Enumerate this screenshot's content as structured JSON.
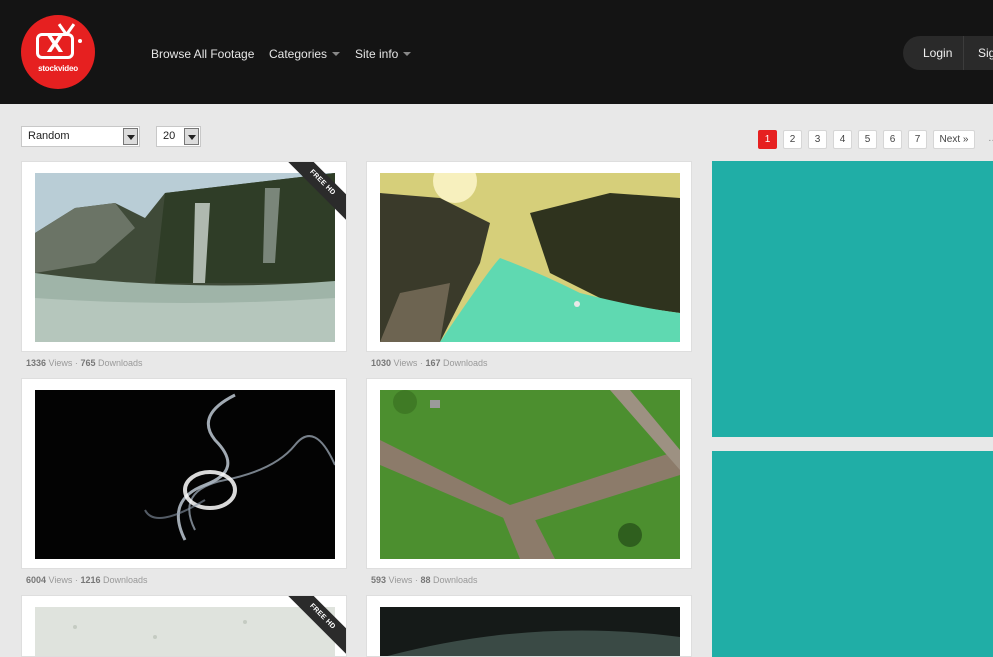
{
  "brand": {
    "logo_text": "stockvideo",
    "logo_mark": "X"
  },
  "nav": {
    "browse": "Browse All Footage",
    "categories": "Categories",
    "site_info": "Site info"
  },
  "auth": {
    "login": "Login",
    "signup": "Sign Up"
  },
  "filters": {
    "sort_value": "Random",
    "per_page_value": "20"
  },
  "pagination": {
    "pages": [
      "1",
      "2",
      "3",
      "4",
      "5",
      "6",
      "7"
    ],
    "active": "1",
    "next": "Next »",
    "ellipsis": "…"
  },
  "videos": [
    {
      "ribbon": "FREE HD",
      "views": "1336",
      "downloads": "765",
      "views_label": "Views",
      "downloads_label": "Downloads",
      "sep": "·"
    },
    {
      "ribbon": "",
      "views": "1030",
      "downloads": "167",
      "views_label": "Views",
      "downloads_label": "Downloads",
      "sep": "·"
    },
    {
      "ribbon": "",
      "views": "6004",
      "downloads": "1216",
      "views_label": "Views",
      "downloads_label": "Downloads",
      "sep": "·"
    },
    {
      "ribbon": "",
      "views": "593",
      "downloads": "88",
      "views_label": "Views",
      "downloads_label": "Downloads",
      "sep": "·"
    },
    {
      "ribbon": "FREE HD",
      "views": "",
      "downloads": ""
    },
    {
      "ribbon": "",
      "views": "",
      "downloads": ""
    }
  ],
  "colors": {
    "accent": "#e62020",
    "header_bg": "#141414",
    "ad_bg": "#20aea6",
    "page_bg": "#e8e8e8"
  }
}
